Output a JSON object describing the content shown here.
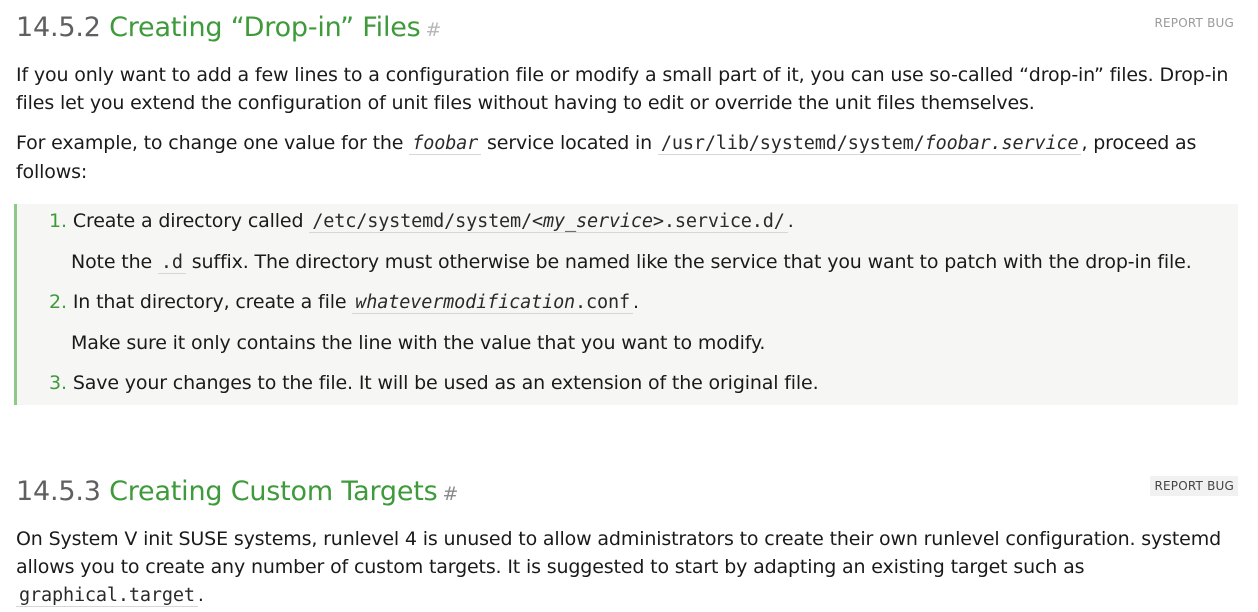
{
  "section1": {
    "number": "14.5.2",
    "title": "Creating “Drop-in” Files",
    "anchor": "#",
    "report_bug": "REPORT BUG",
    "para1": "If you only want to add a few lines to a configuration file or modify a small part of it, you can use so-called “drop-in” files. Drop-in files let you extend the configuration of unit files without having to edit or override the unit files themselves.",
    "para2": {
      "t1": "For example, to change one value for the ",
      "code1": "foobar",
      "t2": " service located in ",
      "code2a": "/usr/lib/systemd/system/",
      "code2b": "foobar.service",
      "t3": ", proceed as follows:"
    },
    "steps": [
      {
        "num": "1.",
        "text": "Create a directory called ",
        "code_a": "/etc/systemd/system/",
        "code_b": "<my_service>",
        "code_c": ".service.d/",
        "end": ".",
        "note_a": "Note the ",
        "note_code": ".d",
        "note_b": " suffix. The directory must otherwise be named like the service that you want to patch with the drop-in file."
      },
      {
        "num": "2.",
        "text": "In that directory, create a file ",
        "code_b": "whatevermodification",
        "code_c": ".conf",
        "end": ".",
        "note": "Make sure it only contains the line with the value that you want to modify."
      },
      {
        "num": "3.",
        "text": "Save your changes to the file. It will be used as an extension of the original file."
      }
    ]
  },
  "section2": {
    "number": "14.5.3",
    "title": "Creating Custom Targets",
    "anchor": "#",
    "report_bug": "REPORT BUG",
    "para": "On System V init SUSE systems, runlevel 4 is unused to allow administrators to create their own runlevel configuration. systemd allows you to create any number of custom targets. It is suggested to start by adapting an existing target such as ",
    "code": "graphical.target",
    "end": "."
  }
}
